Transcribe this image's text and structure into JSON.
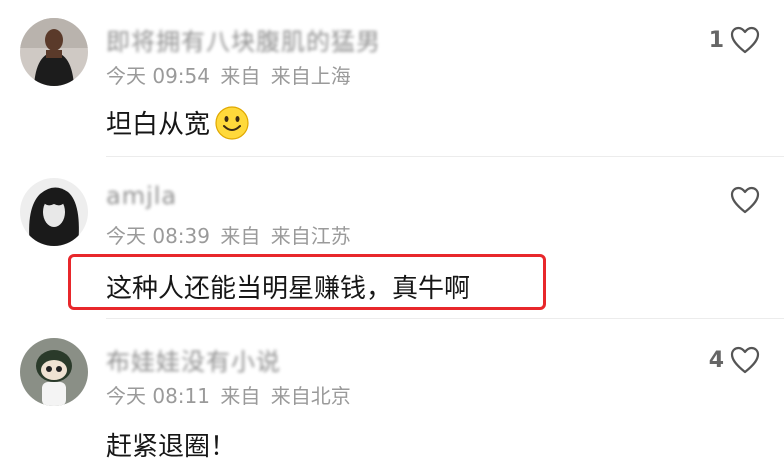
{
  "comments": [
    {
      "username": "即将拥有八块腹肌的猛男",
      "date": "今天 09:54",
      "source": "来自",
      "location": "来自上海",
      "text": "坦白从宽",
      "likes": "1",
      "emoji": "smiley"
    },
    {
      "username": "amjla",
      "date": "今天 08:39",
      "source": "来自",
      "location": "来自江苏",
      "text": "这种人还能当明星赚钱，真牛啊",
      "likes": "",
      "highlighted": true
    },
    {
      "username": "布娃娃没有小说",
      "date": "今天 08:11",
      "source": "来自",
      "location": "来自北京",
      "text": "赶紧退圈！",
      "likes": "4"
    }
  ],
  "colors": {
    "highlight": "#e8272b",
    "meta": "#9a9a9a",
    "text": "#161616"
  }
}
